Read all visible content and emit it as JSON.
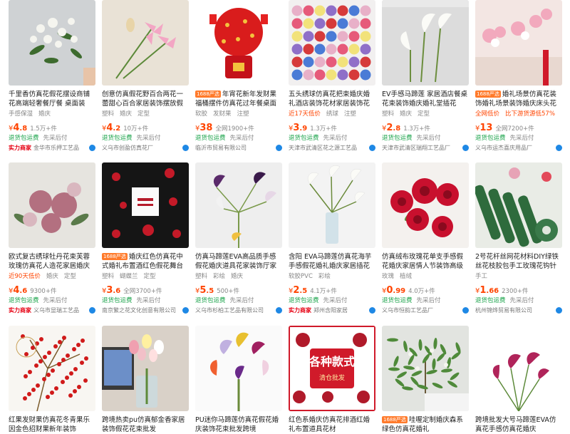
{
  "products": [
    {
      "title": "千里香仿真花假花摆设商铺花高端轻奢餐厅餐 桌面装",
      "badge": "",
      "tags": [
        "手感保湿",
        "婚庆"
      ],
      "tag_highlight": "",
      "price_int": "4",
      "price_dec": ".8",
      "sold": "1.5万+件",
      "service": "退货包运费",
      "service2": "先采后付",
      "verified": "实力商家",
      "shop": "金华市乐押工艺品",
      "img": "whiteflowers"
    },
    {
      "title": "创意仿真假花野百合两花一蕾甜心百合家居装饰摆放假",
      "badge": "",
      "tags": [
        "塑料",
        "婚庆",
        "定型"
      ],
      "tag_highlight": "",
      "price_int": "4",
      "price_dec": ".2",
      "sold": "10万+件",
      "service": "退货包运费",
      "service2": "先采后付",
      "verified": "",
      "shop": "义乌市创盈仿真花厂",
      "img": "lilies"
    },
    {
      "title": "年宵花新年发财果福桶摆件仿真花过年餐桌面装",
      "badge": "1688严选",
      "tags": [
        "软胶",
        "发财果",
        "注塑"
      ],
      "tag_highlight": "",
      "price_int": "38",
      "price_dec": "",
      "sold": "全网1900+件",
      "service": "退货包运费",
      "service2": "先采后付",
      "verified": "",
      "shop": "临沂市贸易有限公司",
      "img": "redfortune"
    },
    {
      "title": "五头绣球仿真花把束婚庆婚礼酒店装饰花材家居装饰花",
      "badge": "",
      "tags": [
        "近17天低价",
        "绣球",
        "注塑"
      ],
      "tag_highlight": "近17天低价",
      "price_int": "3",
      "price_dec": ".9",
      "sold": "1.3万+件",
      "service": "退货包运费",
      "service2": "先采后付",
      "verified": "",
      "shop": "天津市武清区花之源工艺品",
      "img": "hydrangea"
    },
    {
      "title": "EV手感马蹄莲 家居酒店餐桌花束装饰婚庆婚礼堂插花",
      "badge": "",
      "tags": [
        "塑料",
        "婚庆",
        "定型"
      ],
      "tag_highlight": "",
      "price_int": "2",
      "price_dec": ".8",
      "sold": "1.3万+件",
      "service": "退货包运费",
      "service2": "先采后付",
      "verified": "",
      "shop": "天津市武清区瑞翔工艺品厂",
      "img": "calla"
    },
    {
      "title": "婚礼场景仿真花装饰婚礼场景装饰婚庆床头花束",
      "badge": "1688严选",
      "tags": [
        "全网低价",
        "比下游货源低57%"
      ],
      "tag_highlight": "全网低价|比下游货源低57%",
      "price_int": "13",
      "price_dec": "",
      "sold": "全网7200+件",
      "service": "退货包运费",
      "service2": "先采后付",
      "verified": "",
      "shop": "义乌市运杰喜庆用品厂",
      "img": "weddingroom"
    },
    {
      "title": "欧式复古绣球牡丹花束芙蓉玫瑰仿真花人造花家居婚庆",
      "badge": "",
      "tags": [
        "近90天低价",
        "婚庆",
        "定型"
      ],
      "tag_highlight": "近90天低价",
      "price_int": "4",
      "price_dec": ".6",
      "sold": "9300+件",
      "service": "退货包运费",
      "service2": "先采后付",
      "verified": "实力商家",
      "shop": "义乌市显瑞工艺品",
      "img": "vintagebouquet"
    },
    {
      "title": "婚庆红色仿真花中式婚礼布置酒红色假花舞台路",
      "badge": "1688严选",
      "tags": [
        "塑料",
        "蝴蝶兰",
        "定型"
      ],
      "tag_highlight": "",
      "price_int": "3",
      "price_dec": ".6",
      "sold": "全网3700+件",
      "service": "退货包运费",
      "service2": "先采后付",
      "verified": "",
      "shop": "南京繁之花文化创意有限公司",
      "img": "redcatalog"
    },
    {
      "title": "仿真马蹄莲EVA高品质手感假花婚庆道具花家装饰厅家",
      "badge": "",
      "tags": [
        "塑料",
        "彩绘",
        "婚庆"
      ],
      "tag_highlight": "",
      "price_int": "5",
      "price_dec": ".5",
      "sold": "500+件",
      "service": "退货包运费",
      "service2": "先采后付",
      "verified": "",
      "shop": "义乌市杉柏工艺品有限公司",
      "img": "purplecalla"
    },
    {
      "title": "含阳 EVA马蹄莲仿真花海芋手感假花婚礼婚庆家居插花",
      "badge": "",
      "tags": [
        "软胶PVC",
        "彩绘"
      ],
      "tag_highlight": "",
      "price_int": "2",
      "price_dec": ".5",
      "sold": "4.1万+件",
      "service": "退货包运费",
      "service2": "先采后付",
      "verified": "实力商家",
      "shop": "郑州含阳家居",
      "img": "whitecalla"
    },
    {
      "title": "仿真绒布玫瑰花单支手感假花婚庆家居情人节装饰高级",
      "badge": "",
      "tags": [
        "玫瑰",
        "植绒"
      ],
      "tag_highlight": "",
      "price_int": "0",
      "price_dec": ".99",
      "sold": "4.0万+件",
      "service": "退货包运费",
      "service2": "先采后付",
      "verified": "",
      "shop": "义乌市恒韵工艺品厂",
      "img": "redroses"
    },
    {
      "title": "2号花杆丝网花材料DIY绿铁丝花枝胶包手工玫瑰花钩针",
      "badge": "",
      "tags": [
        "手工"
      ],
      "tag_highlight": "",
      "price_int": "1",
      "price_dec": ".66",
      "sold": "2300+件",
      "service": "退货包运费",
      "service2": "先采后付",
      "verified": "",
      "shop": "杭州锦烨贸易有限公司",
      "img": "greentape"
    },
    {
      "title": "红果发财果仿真花冬青果乐因金色招财果新年装饰",
      "badge": "",
      "tags": [],
      "tag_highlight": "",
      "price_int": "",
      "price_dec": "",
      "sold": "",
      "service": "",
      "service2": "",
      "verified": "",
      "shop": "",
      "img": "redberries"
    },
    {
      "title": "跨境热卖pu仿真郁金香家居装饰假花花束批发",
      "badge": "",
      "tags": [],
      "tag_highlight": "",
      "price_int": "",
      "price_dec": "",
      "sold": "",
      "service": "",
      "service2": "",
      "verified": "",
      "shop": "",
      "img": "tulips"
    },
    {
      "title": "PU迷你马蹄莲仿真花假花婚庆装饰花束批发跨境",
      "badge": "",
      "tags": [],
      "tag_highlight": "",
      "price_int": "",
      "price_dec": "",
      "sold": "",
      "service": "",
      "service2": "",
      "verified": "",
      "shop": "",
      "img": "mixcalla"
    },
    {
      "title": "红色系婚庆仿真花排酒红婚礼布置道具花材",
      "badge": "",
      "tags": [],
      "tag_highlight": "",
      "price_int": "",
      "price_dec": "",
      "sold": "",
      "service": "",
      "service2": "",
      "verified": "",
      "shop": "",
      "img": "varietyposter",
      "overlay_text": "各种款式",
      "overlay_sub": "清仓批发"
    },
    {
      "title": "哇喔定制婚庆森系绿色仿真花婚礼",
      "badge": "1688严选",
      "tags": [],
      "tag_highlight": "",
      "price_int": "",
      "price_dec": "",
      "sold": "",
      "service": "",
      "service2": "",
      "verified": "",
      "shop": "",
      "img": "greenplant"
    },
    {
      "title": "跨境批发大号马蹄莲EVA仿真花手感仿真花婚庆",
      "badge": "",
      "tags": [],
      "tag_highlight": "",
      "price_int": "",
      "price_dec": "",
      "sold": "",
      "service": "",
      "service2": "",
      "verified": "",
      "shop": "",
      "img": "pinkcalla"
    }
  ],
  "currency": "¥",
  "colors": {
    "price": "#ff4400",
    "service_green": "#1aa34a",
    "badge_orange": "#ff7a2a",
    "verified_red": "#e60012"
  }
}
